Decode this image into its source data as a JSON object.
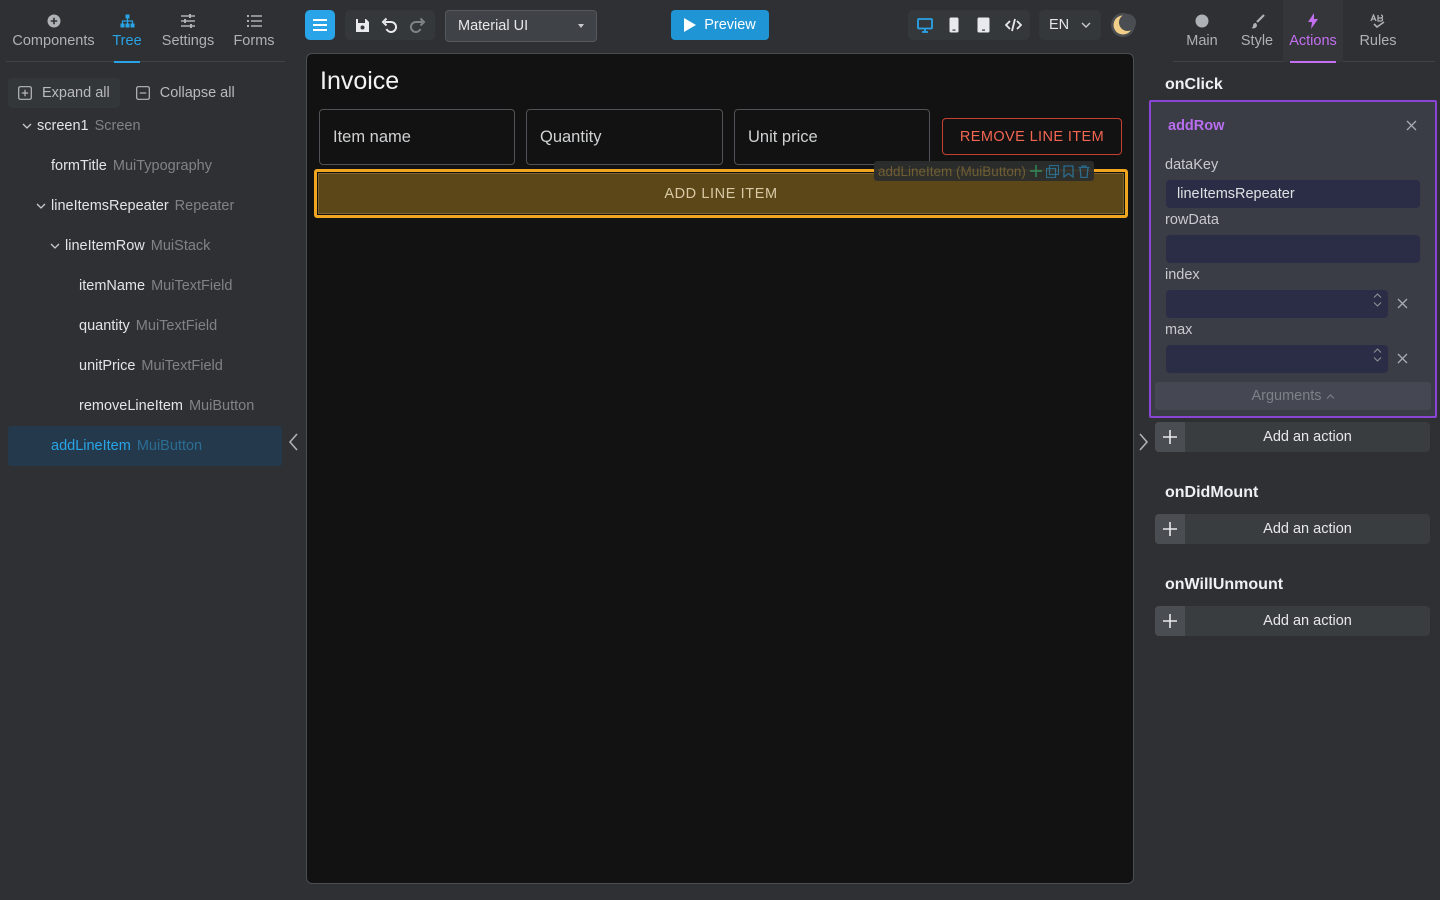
{
  "left_tabs": [
    {
      "label": "Components",
      "icon": "plus-circle-icon"
    },
    {
      "label": "Tree",
      "icon": "tree-icon"
    },
    {
      "label": "Settings",
      "icon": "sliders-icon"
    },
    {
      "label": "Forms",
      "icon": "list-icon"
    }
  ],
  "tree_actions": {
    "expand_all": "Expand all",
    "collapse_all": "Collapse all"
  },
  "tree": [
    {
      "name": "screen1",
      "type": "Screen"
    },
    {
      "name": "formTitle",
      "type": "MuiTypography"
    },
    {
      "name": "lineItemsRepeater",
      "type": "Repeater"
    },
    {
      "name": "lineItemRow",
      "type": "MuiStack"
    },
    {
      "name": "itemName",
      "type": "MuiTextField"
    },
    {
      "name": "quantity",
      "type": "MuiTextField"
    },
    {
      "name": "unitPrice",
      "type": "MuiTextField"
    },
    {
      "name": "removeLineItem",
      "type": "MuiButton"
    },
    {
      "name": "addLineItem",
      "type": "MuiButton"
    }
  ],
  "toolbar": {
    "library": "Material UI",
    "preview": "Preview",
    "language": "EN"
  },
  "canvas": {
    "title": "Invoice",
    "fields": [
      "Item name",
      "Quantity",
      "Unit price"
    ],
    "remove_button": "REMOVE LINE ITEM",
    "add_button": "ADD LINE ITEM",
    "selection_label": "addLineItem (MuiButton)"
  },
  "right_tabs": [
    {
      "label": "Main",
      "icon": "circle-icon"
    },
    {
      "label": "Style",
      "icon": "brush-icon"
    },
    {
      "label": "Actions",
      "icon": "lightning-icon"
    },
    {
      "label": "Rules",
      "icon": "rules-icon"
    }
  ],
  "events": {
    "on_click": {
      "title": "onClick",
      "action": {
        "name": "addRow",
        "args": [
          {
            "label": "dataKey",
            "value": "lineItemsRepeater"
          },
          {
            "label": "rowData",
            "value": ""
          },
          {
            "label": "index",
            "value": ""
          },
          {
            "label": "max",
            "value": ""
          }
        ],
        "arguments_toggle": "Arguments"
      },
      "add_action": "Add an action"
    },
    "on_did_mount": {
      "title": "onDidMount",
      "add_action": "Add an action"
    },
    "on_will_unmount": {
      "title": "onWillUnmount",
      "add_action": "Add an action"
    }
  },
  "colors": {
    "accent_blue": "#2aa4e8",
    "accent_purple": "#c36ff0",
    "selection_orange": "#f0a51e",
    "error_red": "#f26652"
  }
}
